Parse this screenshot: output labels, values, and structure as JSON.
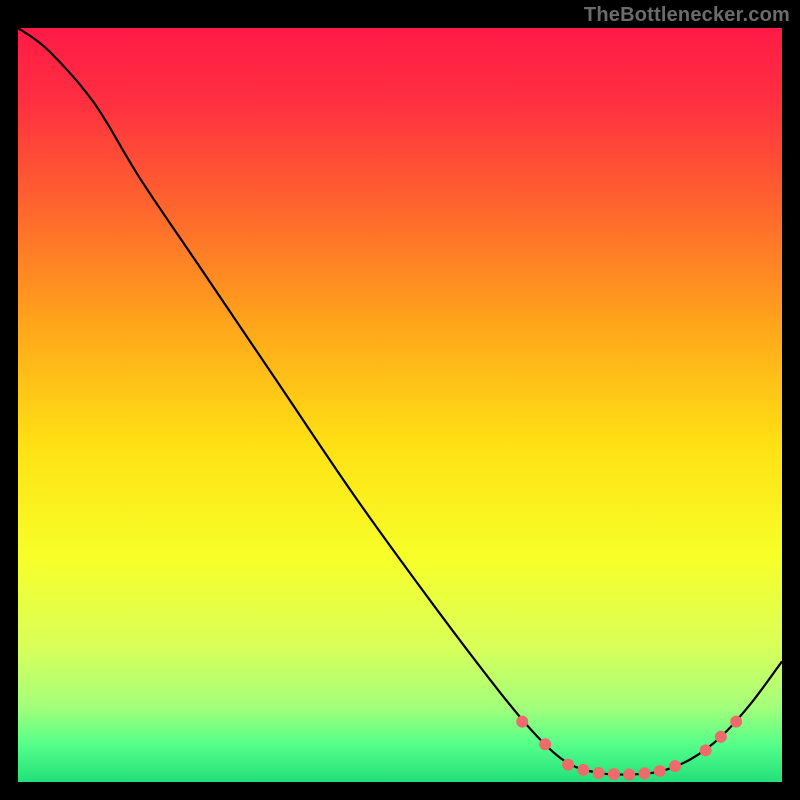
{
  "attribution": "TheBottlenecker.com",
  "chart_data": {
    "type": "line",
    "title": "",
    "xlabel": "",
    "ylabel": "",
    "xlim": [
      0,
      100
    ],
    "ylim": [
      0,
      100
    ],
    "grid": false,
    "legend": false,
    "gradient_stops": [
      {
        "t": 0.0,
        "color": "#ff1a46"
      },
      {
        "t": 0.1,
        "color": "#ff3040"
      },
      {
        "t": 0.25,
        "color": "#ff6a2c"
      },
      {
        "t": 0.4,
        "color": "#ffa81a"
      },
      {
        "t": 0.55,
        "color": "#ffe014"
      },
      {
        "t": 0.7,
        "color": "#f7ff28"
      },
      {
        "t": 0.82,
        "color": "#d9ff5a"
      },
      {
        "t": 0.9,
        "color": "#a4ff7a"
      },
      {
        "t": 0.95,
        "color": "#55ff8a"
      },
      {
        "t": 1.0,
        "color": "#22e07a"
      }
    ],
    "series": [
      {
        "name": "curve",
        "color": "#000000",
        "width": 2.2,
        "points": [
          {
            "x": 0,
            "y": 100
          },
          {
            "x": 4,
            "y": 97
          },
          {
            "x": 10,
            "y": 90
          },
          {
            "x": 16,
            "y": 80
          },
          {
            "x": 24,
            "y": 68
          },
          {
            "x": 34,
            "y": 53
          },
          {
            "x": 44,
            "y": 38
          },
          {
            "x": 54,
            "y": 24
          },
          {
            "x": 63,
            "y": 12
          },
          {
            "x": 68,
            "y": 6
          },
          {
            "x": 72,
            "y": 2.5
          },
          {
            "x": 76,
            "y": 1.2
          },
          {
            "x": 80,
            "y": 1.0
          },
          {
            "x": 84,
            "y": 1.4
          },
          {
            "x": 88,
            "y": 3.0
          },
          {
            "x": 92,
            "y": 6.0
          },
          {
            "x": 96,
            "y": 10.5
          },
          {
            "x": 100,
            "y": 16
          }
        ]
      }
    ],
    "markers": {
      "color": "#ef6b6b",
      "radius": 6,
      "points": [
        {
          "x": 66,
          "y": 8
        },
        {
          "x": 69,
          "y": 5
        },
        {
          "x": 72,
          "y": 2.3
        },
        {
          "x": 74,
          "y": 1.6
        },
        {
          "x": 76,
          "y": 1.2
        },
        {
          "x": 78,
          "y": 1.05
        },
        {
          "x": 80,
          "y": 1.0
        },
        {
          "x": 82,
          "y": 1.15
        },
        {
          "x": 84,
          "y": 1.45
        },
        {
          "x": 86,
          "y": 2.1
        },
        {
          "x": 90,
          "y": 4.2
        },
        {
          "x": 92,
          "y": 6.0
        },
        {
          "x": 94,
          "y": 8.0
        }
      ]
    }
  }
}
